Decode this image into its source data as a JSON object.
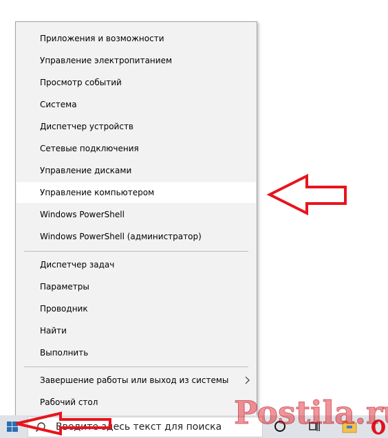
{
  "menu": {
    "items": [
      {
        "label": "Приложения и возможности"
      },
      {
        "label": "Управление электропитанием"
      },
      {
        "label": "Просмотр событий"
      },
      {
        "label": "Система"
      },
      {
        "label": "Диспетчер устройств"
      },
      {
        "label": "Сетевые подключения"
      },
      {
        "label": "Управление дисками"
      },
      {
        "label": "Управление компьютером",
        "highlighted": true
      },
      {
        "label": "Windows PowerShell"
      },
      {
        "label": "Windows PowerShell (администратор)"
      },
      {
        "label": "Диспетчер задач"
      },
      {
        "label": "Параметры"
      },
      {
        "label": "Проводник"
      },
      {
        "label": "Найти"
      },
      {
        "label": "Выполнить"
      },
      {
        "label": "Завершение работы или выход из системы",
        "has_submenu": true
      },
      {
        "label": "Рабочий стол"
      }
    ]
  },
  "taskbar": {
    "search_text": "Введите здесь текст для поиска",
    "icons": [
      "windows-logo-icon",
      "search-icon",
      "cortana-icon",
      "task-view-icon",
      "file-explorer-icon",
      "opera-icon"
    ]
  },
  "watermark": {
    "text": "Postila.ru"
  },
  "colors": {
    "menu_background": "#f2f2f2",
    "menu_highlight": "#ffffff",
    "annotation_arrow": "#e8141c",
    "taskbar": "#dfe3e8",
    "windows_logo": "#2b6fb6",
    "explorer_folder": "#f2c14e",
    "opera_red": "#e0141e"
  }
}
